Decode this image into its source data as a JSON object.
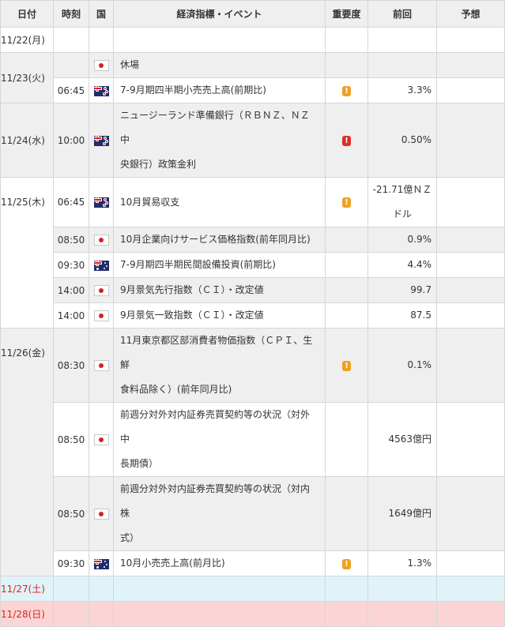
{
  "headers": {
    "date": "日付",
    "time": "時刻",
    "country": "国",
    "event": "経済指標・イベント",
    "importance": "重要度",
    "previous": "前回",
    "forecast": "予想"
  },
  "importance_glyph": "!",
  "colors": {
    "header_bg": "#efefef",
    "saturday_bg": "#dff3f9",
    "sunday_bg": "#fbd5d5",
    "weekend_text": "#d9261c",
    "importance_mid": "#f0a020",
    "importance_high": "#dd2c2c"
  },
  "days": [
    {
      "date": "11/22(月)",
      "events": []
    },
    {
      "date": "11/23(火)",
      "events": [
        {
          "time": "",
          "country": "jp-flag-icon",
          "event": "休場",
          "importance": "",
          "previous": "",
          "forecast": ""
        },
        {
          "time": "06:45",
          "country": "nz-flag-icon",
          "event": "7-9月期四半期小売売上高(前期比)",
          "importance": "mid",
          "previous": "3.3%",
          "forecast": ""
        }
      ]
    },
    {
      "date": "11/24(水)",
      "events": [
        {
          "time": "10:00",
          "country": "nz-flag-icon",
          "event_line1": "ニュージーランド準備銀行（ＲＢＮＺ、ＮＺ中",
          "event_line2": "央銀行）政策金利",
          "importance": "high",
          "previous": "0.50%",
          "forecast": ""
        }
      ]
    },
    {
      "date": "11/25(木)",
      "events": [
        {
          "time": "06:45",
          "country": "nz-flag-icon",
          "event": "10月貿易収支",
          "importance": "mid",
          "previous_line1": "-21.71億ＮＺ",
          "previous_line2": "ドル",
          "forecast": ""
        },
        {
          "time": "08:50",
          "country": "jp-flag-icon",
          "event": "10月企業向けサービス価格指数(前年同月比)",
          "importance": "",
          "previous": "0.9%",
          "forecast": ""
        },
        {
          "time": "09:30",
          "country": "au-flag-icon",
          "event": "7-9月期四半期民間設備投資(前期比)",
          "importance": "",
          "previous": "4.4%",
          "forecast": ""
        },
        {
          "time": "14:00",
          "country": "jp-flag-icon",
          "event": "9月景気先行指数（ＣＩ）・改定値",
          "importance": "",
          "previous": "99.7",
          "forecast": ""
        },
        {
          "time": "14:00",
          "country": "jp-flag-icon",
          "event": "9月景気一致指数（ＣＩ）・改定値",
          "importance": "",
          "previous": "87.5",
          "forecast": ""
        }
      ]
    },
    {
      "date": "11/26(金)",
      "events": [
        {
          "time": "08:30",
          "country": "jp-flag-icon",
          "event_line1": "11月東京都区部消費者物価指数（ＣＰＩ、生鮮",
          "event_line2": "食料品除く）(前年同月比)",
          "importance": "mid",
          "previous": "0.1%",
          "forecast": ""
        },
        {
          "time": "08:50",
          "country": "jp-flag-icon",
          "event_line1": "前週分対外対内証券売買契約等の状況（対外中",
          "event_line2": "長期債）",
          "importance": "",
          "previous": "4563億円",
          "forecast": ""
        },
        {
          "time": "08:50",
          "country": "jp-flag-icon",
          "event_line1": "前週分対外対内証券売買契約等の状況（対内株",
          "event_line2": "式）",
          "importance": "",
          "previous": "1649億円",
          "forecast": ""
        },
        {
          "time": "09:30",
          "country": "au-flag-icon",
          "event": "10月小売売上高(前月比)",
          "importance": "mid",
          "previous": "1.3%",
          "forecast": ""
        }
      ]
    },
    {
      "date": "11/27(土)",
      "events": []
    },
    {
      "date": "11/28(日)",
      "events": []
    }
  ]
}
